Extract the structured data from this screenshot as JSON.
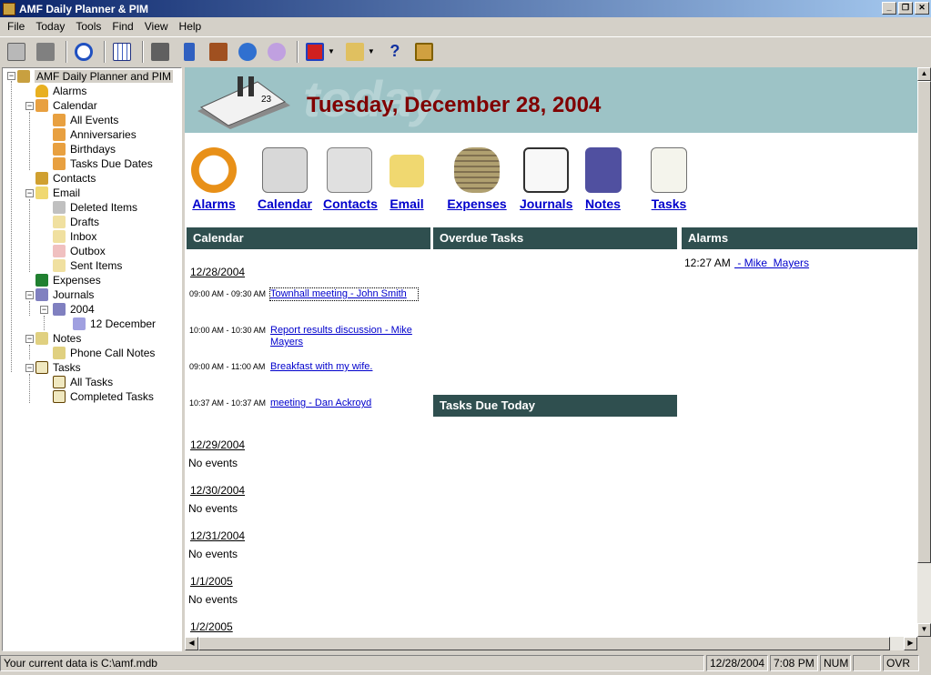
{
  "window": {
    "title": "AMF Daily Planner & PIM"
  },
  "menu": [
    "File",
    "Today",
    "Tools",
    "Find",
    "View",
    "Help"
  ],
  "toolbar_icons": [
    "print-icon",
    "print-setup-icon",
    "refresh-icon",
    "calendar-grid-icon",
    "phone-icon",
    "calculator-icon",
    "tools-icon",
    "globe-icon",
    "gears-icon",
    "new-item-icon",
    "edit-icon",
    "help-icon",
    "exit-door-icon"
  ],
  "tree": [
    {
      "label": "AMF Daily Planner and PIM",
      "icon": "app-icon",
      "level": 0
    },
    {
      "label": "Alarms",
      "icon": "bell-icon",
      "level": 1
    },
    {
      "label": "Calendar",
      "icon": "calendar-icon",
      "level": 1
    },
    {
      "label": "All Events",
      "icon": "calendar-icon",
      "level": 2
    },
    {
      "label": "Anniversaries",
      "icon": "calendar-icon",
      "level": 2
    },
    {
      "label": "Birthdays",
      "icon": "calendar-icon",
      "level": 2
    },
    {
      "label": "Tasks Due Dates",
      "icon": "calendar-icon",
      "level": 2
    },
    {
      "label": "Contacts",
      "icon": "contacts-icon",
      "level": 1
    },
    {
      "label": "Email",
      "icon": "email-icon",
      "level": 1
    },
    {
      "label": "Deleted Items",
      "icon": "trash-icon",
      "level": 2
    },
    {
      "label": "Drafts",
      "icon": "drafts-icon",
      "level": 2
    },
    {
      "label": "Inbox",
      "icon": "inbox-icon",
      "level": 2
    },
    {
      "label": "Outbox",
      "icon": "outbox-icon",
      "level": 2
    },
    {
      "label": "Sent Items",
      "icon": "sent-icon",
      "level": 2
    },
    {
      "label": "Expenses",
      "icon": "money-icon",
      "level": 1
    },
    {
      "label": "Journals",
      "icon": "journal-icon",
      "level": 1
    },
    {
      "label": "2004",
      "icon": "journal-icon",
      "level": 2
    },
    {
      "label": "12 December",
      "icon": "journal-page-icon",
      "level": 3
    },
    {
      "label": "Notes",
      "icon": "notes-icon",
      "level": 1
    },
    {
      "label": "Phone Call Notes",
      "icon": "notes-icon",
      "level": 2
    },
    {
      "label": "Tasks",
      "icon": "tasks-icon",
      "level": 1
    },
    {
      "label": "All Tasks",
      "icon": "tasks-icon",
      "level": 2
    },
    {
      "label": "Completed Tasks",
      "icon": "tasks-icon",
      "level": 2
    }
  ],
  "banner": {
    "watermark": "today",
    "date": "Tuesday, December 28, 2004"
  },
  "nav": [
    "Alarms",
    "Calendar",
    "Contacts",
    "Email",
    "Expenses",
    "Journals",
    "Notes",
    "Tasks"
  ],
  "sections": {
    "calendar": "Calendar",
    "overdue": "Overdue Tasks",
    "alarms": "Alarms",
    "due_today": "Tasks Due Today"
  },
  "calendar_days": [
    {
      "date": "12/28/2004",
      "events": [
        {
          "time": "09:00 AM - 09:30 AM",
          "title": "Townhall meeting - John  Smith"
        },
        {
          "time": "10:00 AM - 10:30 AM",
          "title": "Report results discussion - Mike Mayers"
        },
        {
          "time": "09:00 AM - 11:00 AM",
          "title": "Breakfast with my wife."
        },
        {
          "time": "10:37 AM - 10:37 AM",
          "title": "meeting - Dan  Ackroyd"
        }
      ]
    },
    {
      "date": "12/29/2004",
      "no_events": "No events"
    },
    {
      "date": "12/30/2004",
      "no_events": "No events"
    },
    {
      "date": "12/31/2004",
      "no_events": "No events"
    },
    {
      "date": "1/1/2005",
      "no_events": "No events"
    },
    {
      "date": "1/2/2005"
    }
  ],
  "alarms": [
    {
      "time": "12:27 AM",
      "title": " - Mike  Mayers"
    }
  ],
  "status": {
    "path": "Your current data is C:\\amf.mdb",
    "date": "12/28/2004",
    "time": "7:08 PM",
    "num": "NUM",
    "blank": "",
    "ovr": "OVR"
  },
  "colors": {
    "section_header": "#2f4f4f",
    "banner": "#9dc3c6",
    "date": "#800000",
    "link": "#0000cc"
  }
}
